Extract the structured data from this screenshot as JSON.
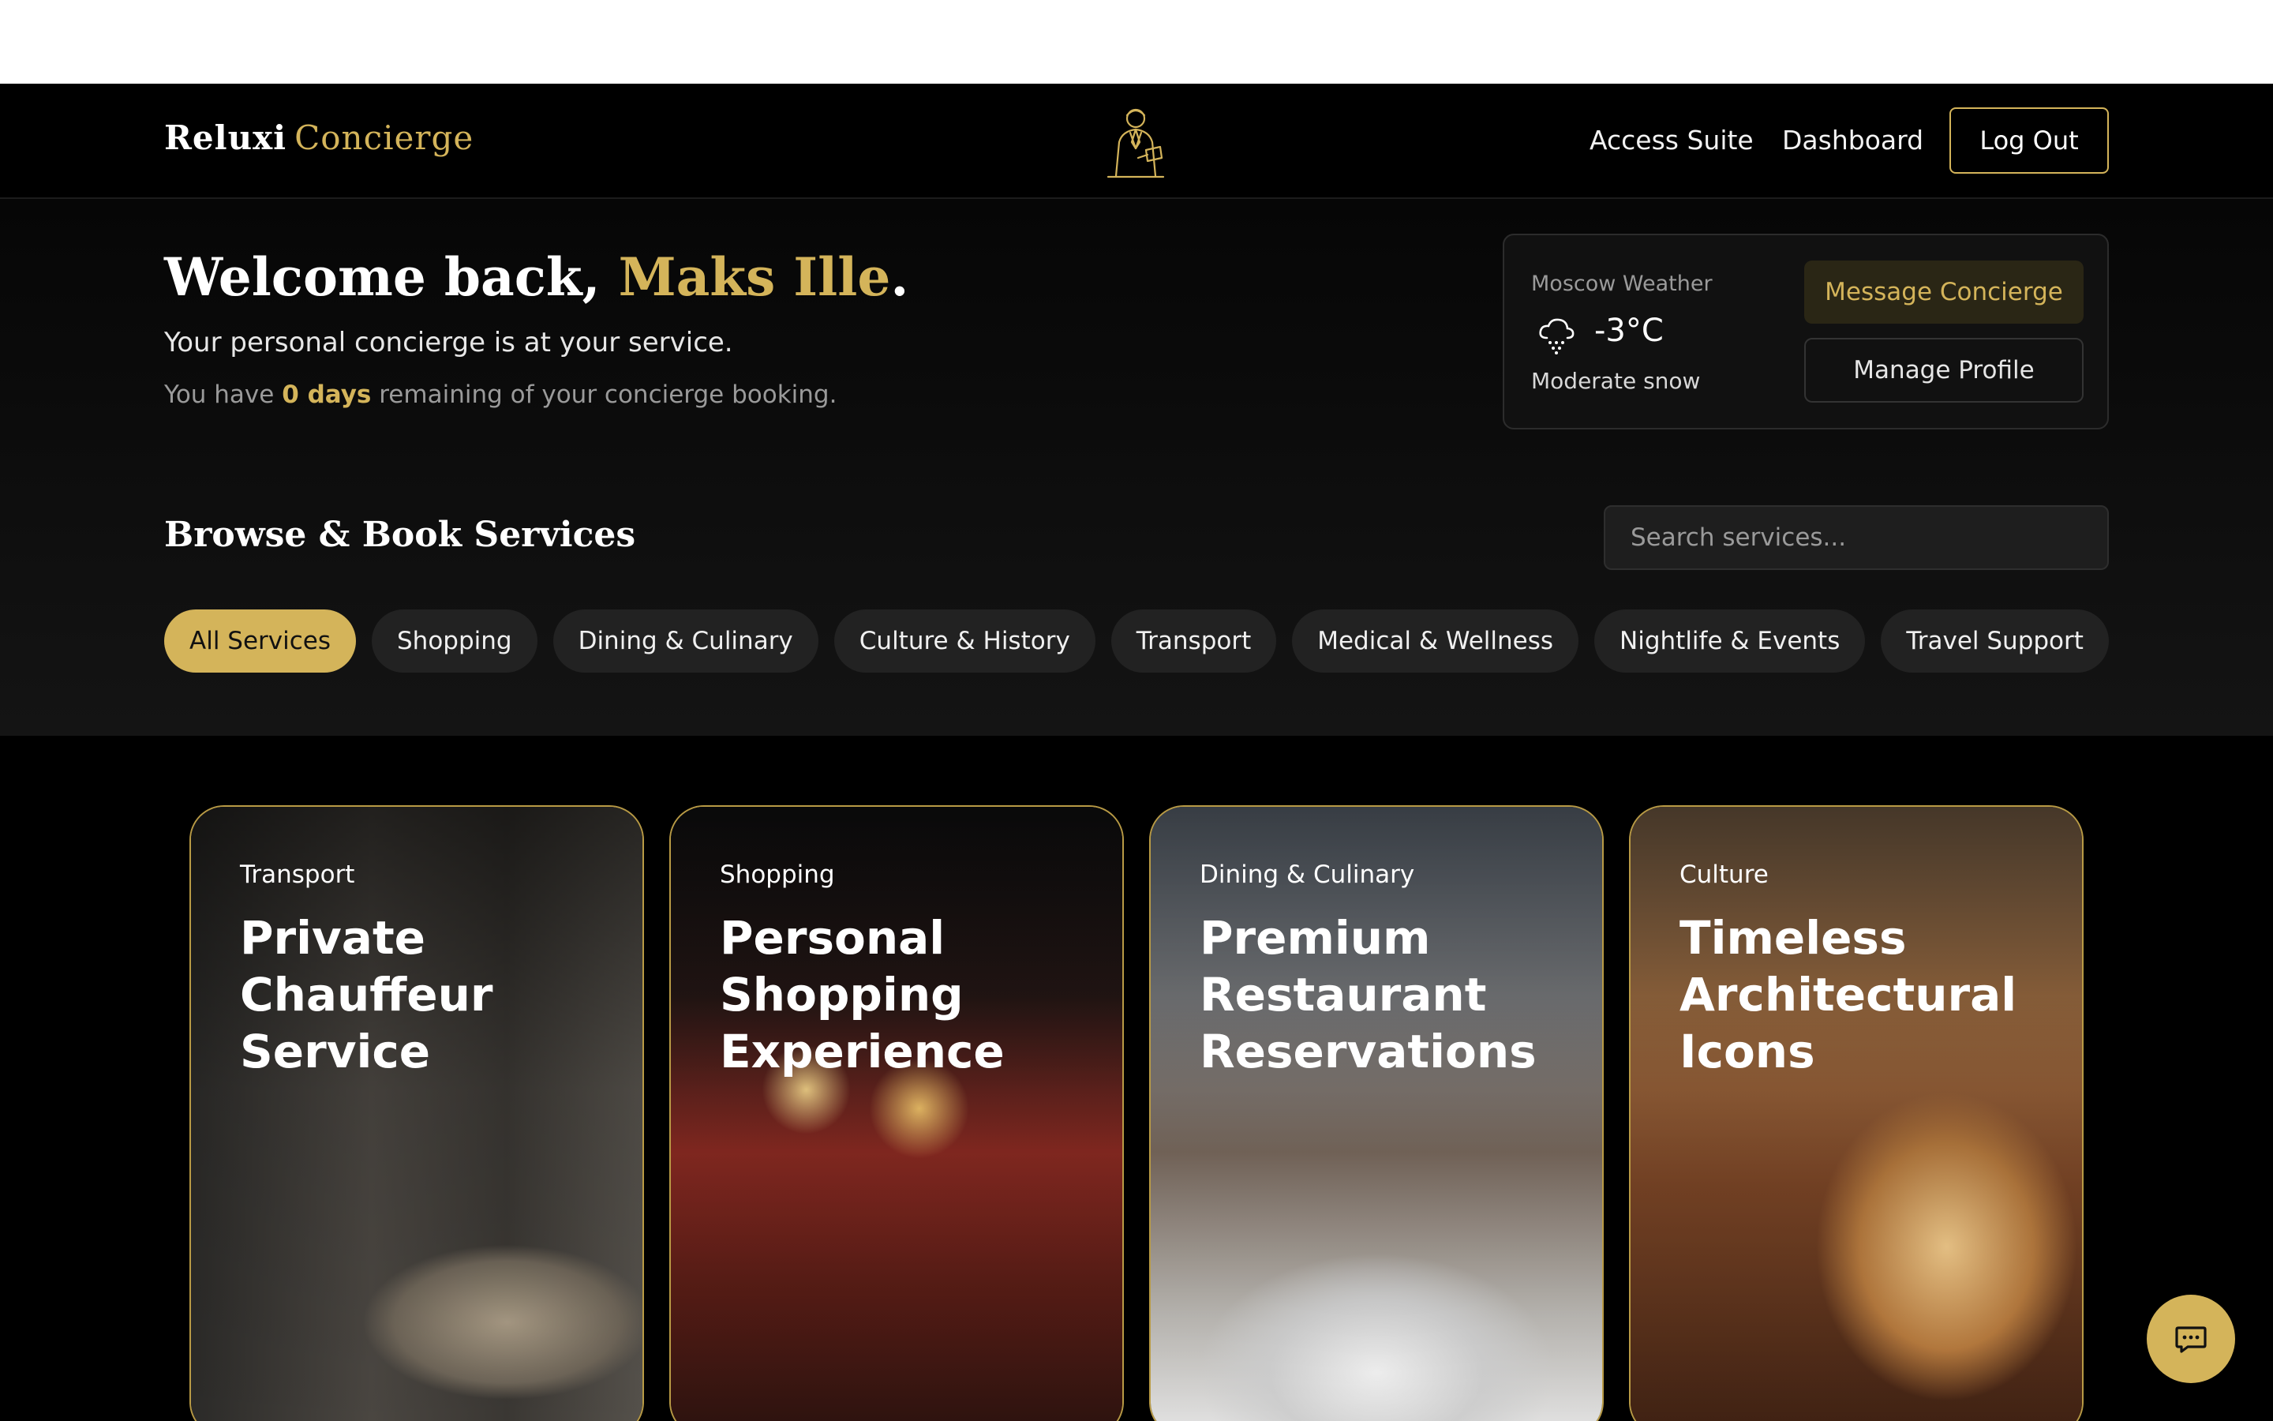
{
  "nav": {
    "brand_main": "Reluxi",
    "brand_accent": "Concierge",
    "links": [
      "Access Suite",
      "Dashboard"
    ],
    "logout_label": "Log Out",
    "logo_icon": "concierge-figure-icon"
  },
  "hero": {
    "welcome_prefix": "Welcome back, ",
    "user_name": "Maks Ille",
    "welcome_suffix": ".",
    "subtitle": "Your personal concierge is at your service.",
    "remaining_prefix": "You have ",
    "remaining_days": "0 days",
    "remaining_suffix": " remaining of your concierge booking."
  },
  "weather": {
    "label": "Moscow Weather",
    "icon": "snow-cloud-icon",
    "temperature": "-3°C",
    "description": "Moderate snow",
    "message_button": "Message Concierge",
    "profile_button": "Manage Profile"
  },
  "services": {
    "title": "Browse & Book Services",
    "search_placeholder": "Search services...",
    "filters": [
      "All Services",
      "Shopping",
      "Dining & Culinary",
      "Culture & History",
      "Transport",
      "Medical & Wellness",
      "Nightlife & Events",
      "Travel Support"
    ],
    "active_filter": "All Services"
  },
  "cards": [
    {
      "category": "Transport",
      "title": "Private Chauffeur Service"
    },
    {
      "category": "Shopping",
      "title": "Personal Shopping Experience"
    },
    {
      "category": "Dining & Culinary",
      "title": "Premium Restaurant Reservations"
    },
    {
      "category": "Culture",
      "title": "Timeless Architectural Icons"
    }
  ],
  "chat": {
    "icon": "chat-bubble-icon"
  },
  "colors": {
    "accent": "#d4b45a",
    "background": "#000000",
    "panel": "#111111"
  }
}
